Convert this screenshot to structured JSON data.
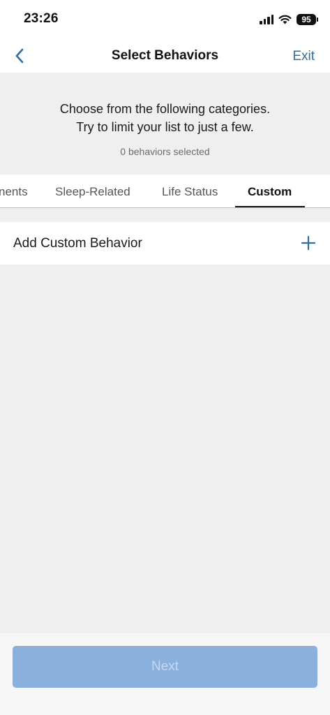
{
  "status_bar": {
    "time": "23:26",
    "battery": "95",
    "icons": [
      "signal-icon",
      "wifi-icon",
      "battery-icon"
    ]
  },
  "nav": {
    "back_icon": "chevron-left-icon",
    "title": "Select Behaviors",
    "exit_label": "Exit"
  },
  "intro": {
    "line1": "Choose from the following categories.",
    "line2": "Try to limit your list to just a few.",
    "selected_count": "0 behaviors selected"
  },
  "tabs": [
    {
      "label": "nents",
      "active": false
    },
    {
      "label": "Sleep-Related",
      "active": false
    },
    {
      "label": "Life Status",
      "active": false
    },
    {
      "label": "Custom",
      "active": true
    }
  ],
  "custom": {
    "add_label": "Add Custom Behavior",
    "add_icon": "plus-icon"
  },
  "footer": {
    "next_label": "Next",
    "next_enabled": false
  },
  "colors": {
    "accent": "#2d6fa3",
    "background": "#efefef",
    "next_button_disabled": "#8ab0de",
    "next_text_disabled": "#c6d9f0"
  }
}
